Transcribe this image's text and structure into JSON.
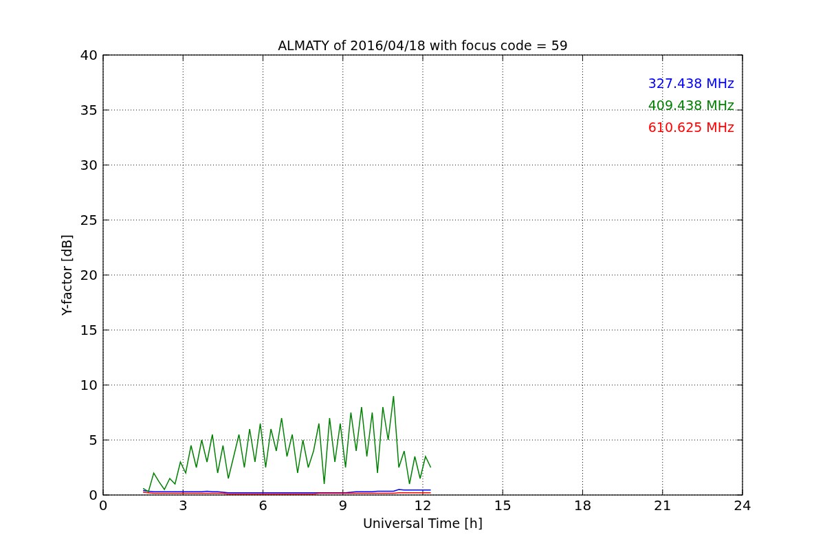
{
  "chart_data": {
    "type": "line",
    "title": "ALMATY of 2016/04/18 with focus code = 59",
    "xlabel": "Universal Time [h]",
    "ylabel": "Y-factor [dB]",
    "x": [
      1.5,
      1.7,
      1.9,
      2.1,
      2.3,
      2.5,
      2.7,
      2.9,
      3.1,
      3.3,
      3.5,
      3.7,
      3.9,
      4.1,
      4.3,
      4.5,
      4.7,
      4.9,
      5.1,
      5.3,
      5.5,
      5.7,
      5.9,
      6.1,
      6.3,
      6.5,
      6.7,
      6.9,
      7.1,
      7.3,
      7.5,
      7.7,
      7.9,
      8.1,
      8.3,
      8.5,
      8.7,
      8.9,
      9.1,
      9.3,
      9.5,
      9.7,
      9.9,
      10.1,
      10.3,
      10.5,
      10.7,
      10.9,
      11.1,
      11.3,
      11.5,
      11.7,
      11.9,
      12.1,
      12.3
    ],
    "grid": true,
    "xlim": [
      0,
      24
    ],
    "ylim": [
      0,
      40
    ],
    "xticks": [
      0,
      3,
      6,
      9,
      12,
      15,
      18,
      21,
      24
    ],
    "yticks": [
      0,
      5,
      10,
      15,
      20,
      25,
      30,
      35,
      40
    ],
    "series": [
      {
        "name": "327.438 MHz",
        "color": "#0000ff",
        "values": [
          0.4,
          0.35,
          0.3,
          0.3,
          0.3,
          0.3,
          0.3,
          0.3,
          0.3,
          0.3,
          0.3,
          0.3,
          0.35,
          0.3,
          0.3,
          0.25,
          0.2,
          0.2,
          0.2,
          0.2,
          0.2,
          0.2,
          0.2,
          0.2,
          0.2,
          0.2,
          0.2,
          0.2,
          0.2,
          0.2,
          0.2,
          0.2,
          0.2,
          0.2,
          0.2,
          0.2,
          0.2,
          0.2,
          0.2,
          0.25,
          0.3,
          0.3,
          0.3,
          0.3,
          0.35,
          0.35,
          0.35,
          0.35,
          0.5,
          0.45,
          0.45,
          0.45,
          0.45,
          0.45,
          0.45
        ]
      },
      {
        "name": "409.438 MHz",
        "color": "#008000",
        "values": [
          0.6,
          0.3,
          2.0,
          1.2,
          0.5,
          1.5,
          1.0,
          3.0,
          2.0,
          4.5,
          2.5,
          5.0,
          3.0,
          5.5,
          2.0,
          4.5,
          1.5,
          3.5,
          5.5,
          2.5,
          6.0,
          3.0,
          6.5,
          2.5,
          6.0,
          4.0,
          7.0,
          3.5,
          5.5,
          2.0,
          5.0,
          2.5,
          4.0,
          6.5,
          1.0,
          7.0,
          3.0,
          6.5,
          2.5,
          7.5,
          4.0,
          8.0,
          3.5,
          7.5,
          2.0,
          8.0,
          5.0,
          9.0,
          2.5,
          4.0,
          1.0,
          3.5,
          1.5,
          3.5,
          2.5
        ]
      },
      {
        "name": "610.625 MHz",
        "color": "#ff0000",
        "values": [
          0.25,
          0.2,
          0.15,
          0.15,
          0.15,
          0.15,
          0.15,
          0.15,
          0.15,
          0.15,
          0.15,
          0.15,
          0.15,
          0.15,
          0.15,
          0.15,
          0.1,
          0.1,
          0.1,
          0.1,
          0.1,
          0.1,
          0.1,
          0.1,
          0.1,
          0.1,
          0.1,
          0.1,
          0.1,
          0.1,
          0.1,
          0.1,
          0.1,
          0.15,
          0.15,
          0.15,
          0.15,
          0.15,
          0.15,
          0.15,
          0.15,
          0.15,
          0.15,
          0.15,
          0.15,
          0.15,
          0.15,
          0.15,
          0.2,
          0.2,
          0.2,
          0.2,
          0.2,
          0.2,
          0.2
        ]
      }
    ]
  }
}
